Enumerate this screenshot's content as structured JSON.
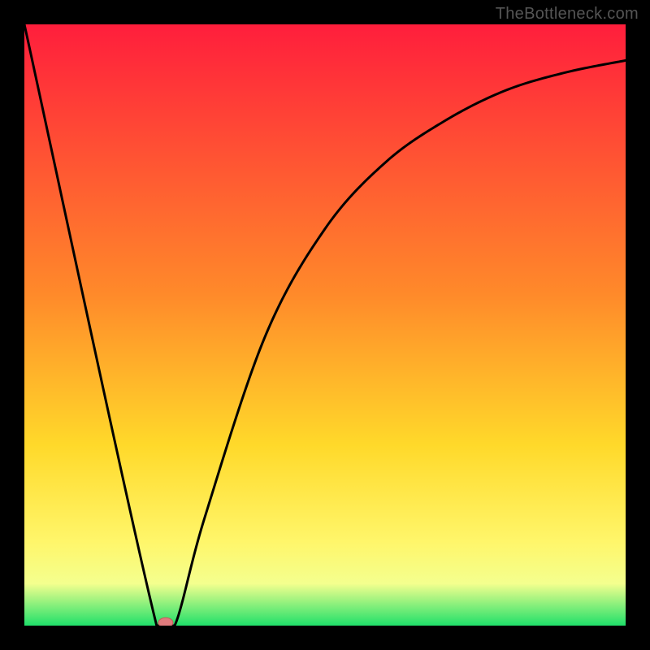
{
  "attribution": "TheBottleneck.com",
  "chart_data": {
    "type": "line",
    "title": "",
    "xlabel": "",
    "ylabel": "",
    "xlim": [
      0,
      100
    ],
    "ylim": [
      0,
      100
    ],
    "x": [
      0,
      22,
      25,
      30,
      40,
      50,
      60,
      70,
      80,
      90,
      100
    ],
    "values": [
      100,
      0,
      0,
      18,
      48,
      66,
      77,
      84,
      89,
      92,
      94
    ],
    "marker": {
      "x": 23.5,
      "y": 0.5
    },
    "gradient_stops": [
      {
        "offset": 0.0,
        "color": "#ff1e3c"
      },
      {
        "offset": 0.45,
        "color": "#ff8a2a"
      },
      {
        "offset": 0.7,
        "color": "#ffd92a"
      },
      {
        "offset": 0.86,
        "color": "#fff66a"
      },
      {
        "offset": 0.93,
        "color": "#f4ff8e"
      },
      {
        "offset": 1.0,
        "color": "#20e06a"
      }
    ],
    "colors": {
      "curve": "#000000",
      "marker_fill": "#e07b7d",
      "marker_stroke": "#c55a5c",
      "frame": "#000000"
    }
  }
}
